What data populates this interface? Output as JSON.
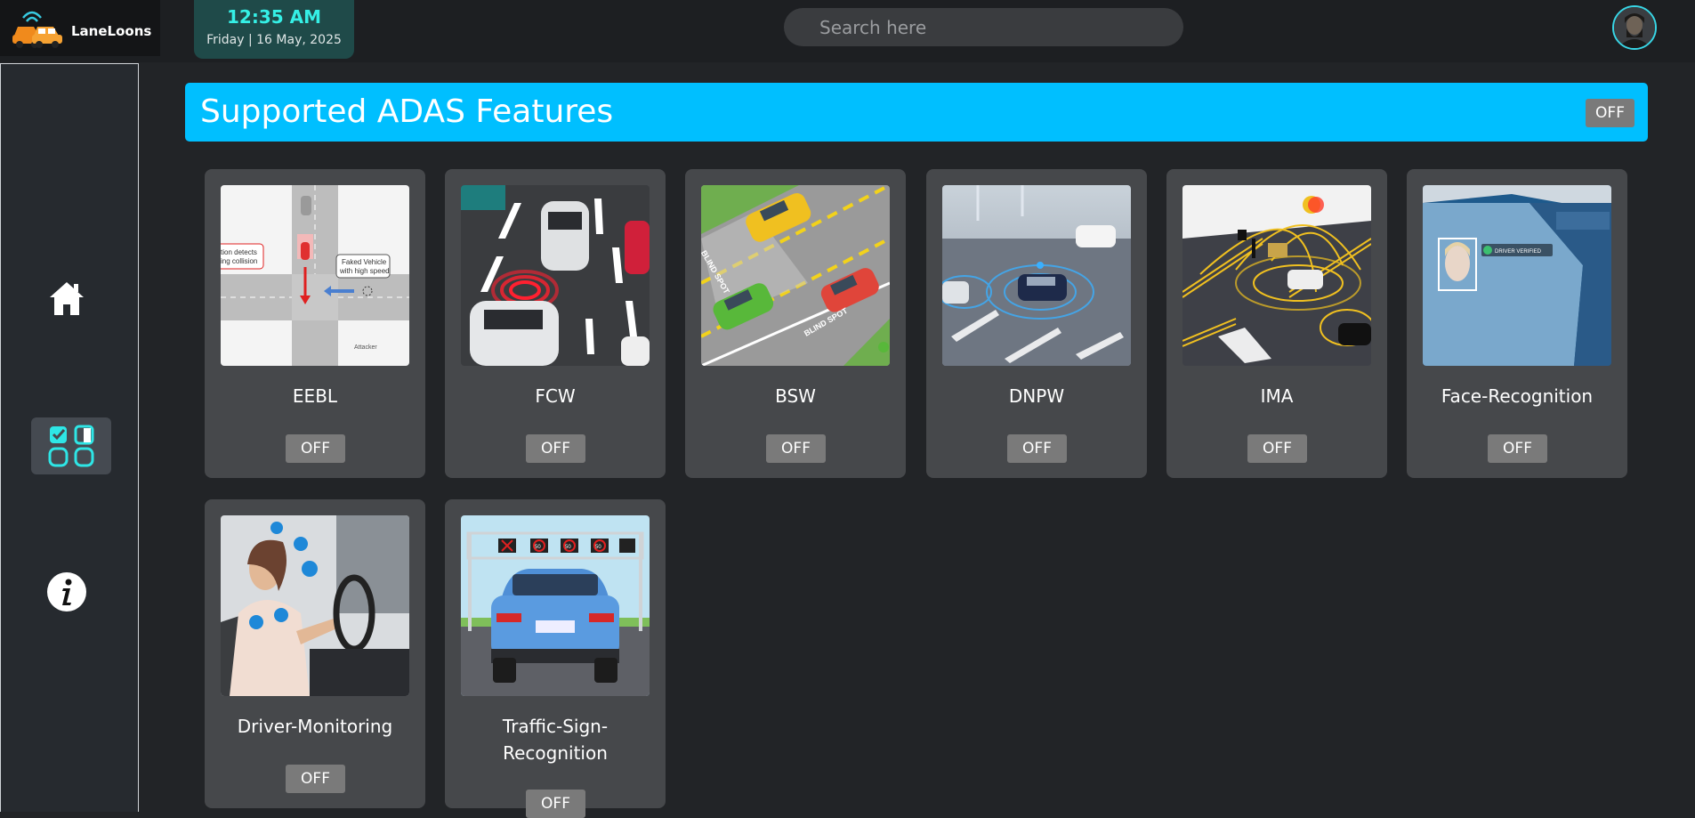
{
  "app": {
    "name": "LaneLoons",
    "logo_icon": "car-logo-icon"
  },
  "header": {
    "time": "12:35 AM",
    "date": "Friday | 16 May, 2025",
    "search_placeholder": "Search here",
    "avatar_icon": "user-avatar-icon"
  },
  "sidebar": {
    "items": [
      {
        "name": "home",
        "icon": "home-icon",
        "active": false
      },
      {
        "name": "features",
        "icon": "features-grid-icon",
        "active": true
      },
      {
        "name": "info",
        "icon": "info-icon",
        "active": false
      }
    ]
  },
  "banner": {
    "title": "Supported ADAS Features",
    "toggle": "OFF"
  },
  "colors": {
    "accent": "#00bfff",
    "clock_text": "#35f0e6",
    "card": "#46484b",
    "toggle_off": "#7a7a7a"
  },
  "features": [
    {
      "name": "EEBL",
      "toggle": "OFF",
      "image_callout_1": "tion detects",
      "image_callout_2": "ing collision",
      "image_callout_3": "Faked Vehicle",
      "image_callout_4": "with high speed",
      "image_watermark": "Attacker"
    },
    {
      "name": "FCW",
      "toggle": "OFF"
    },
    {
      "name": "BSW",
      "toggle": "OFF",
      "image_text_1": "BLIND SPOT",
      "image_text_2": "BLIND SPOT"
    },
    {
      "name": "DNPW",
      "toggle": "OFF"
    },
    {
      "name": "IMA",
      "toggle": "OFF"
    },
    {
      "name": "Face-Recognition",
      "toggle": "OFF",
      "image_badge": "DRIVER VERIFIED"
    },
    {
      "name": "Driver-Monitoring",
      "toggle": "OFF"
    },
    {
      "name": "Traffic-Sign-Recognition",
      "toggle": "OFF",
      "image_sign_1": "50",
      "image_sign_2": "50",
      "image_sign_3": "50"
    }
  ]
}
